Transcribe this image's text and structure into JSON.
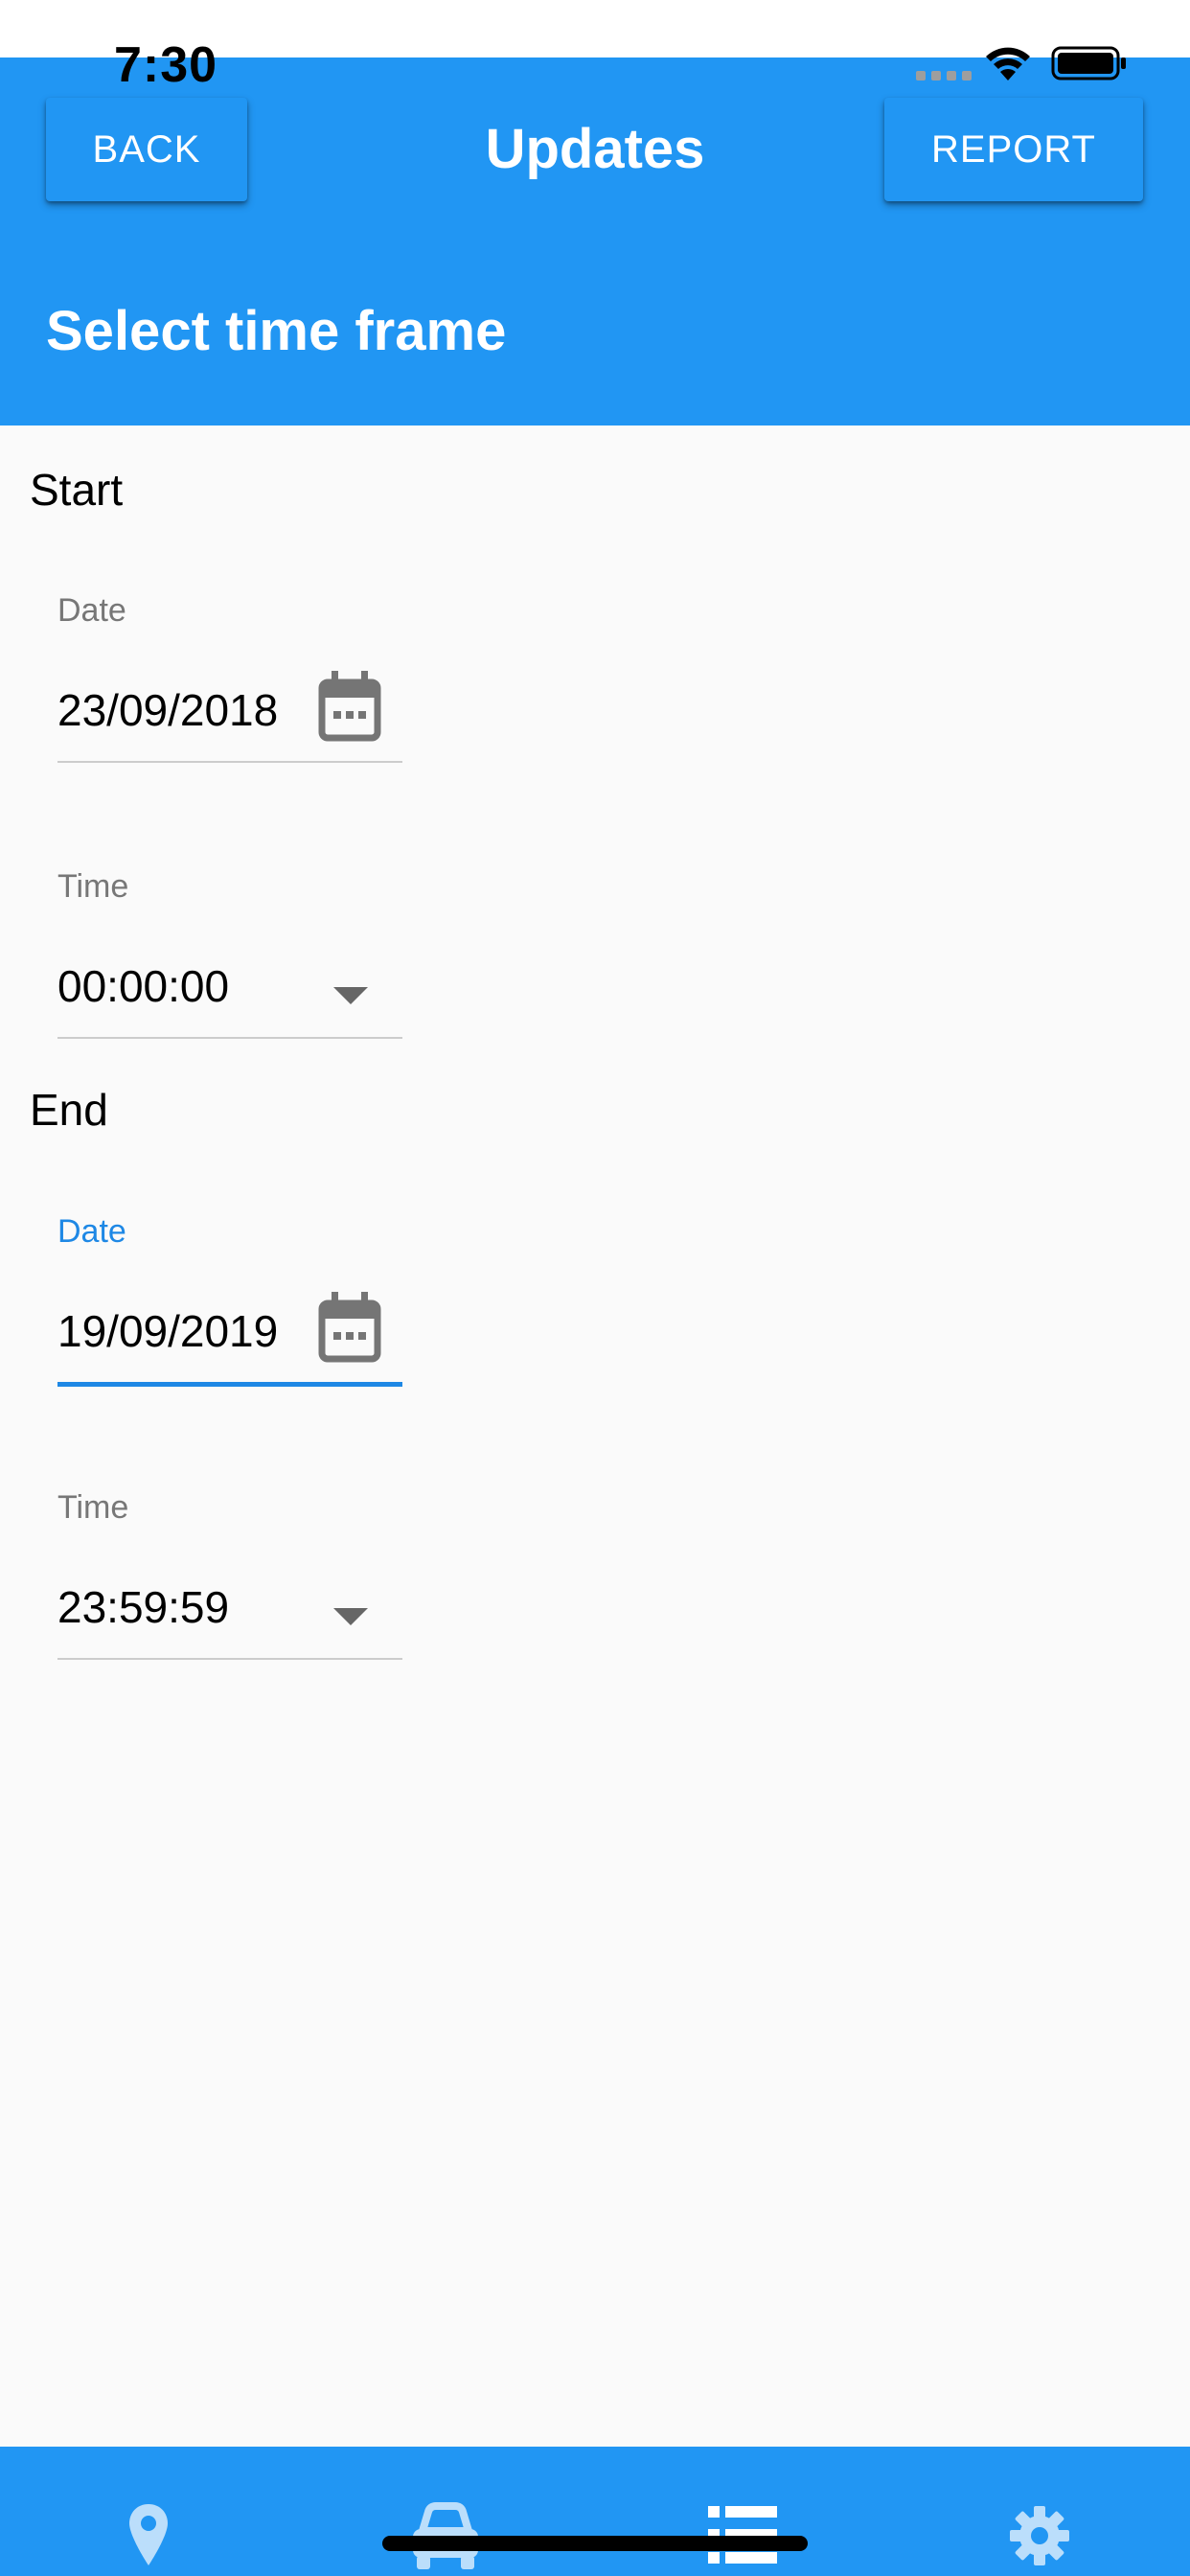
{
  "status_bar": {
    "time": "7:30"
  },
  "header": {
    "back_label": "BACK",
    "title": "Updates",
    "report_label": "REPORT",
    "subtitle": "Select time frame"
  },
  "start": {
    "label": "Start",
    "date_label": "Date",
    "date_value": "23/09/2018",
    "time_label": "Time",
    "time_value": "00:00:00"
  },
  "end": {
    "label": "End",
    "date_label": "Date",
    "date_value": "19/09/2019",
    "time_label": "Time",
    "time_value": "23:59:59"
  },
  "tabbar": {
    "items": [
      {
        "icon": "location-pin-icon"
      },
      {
        "icon": "car-icon"
      },
      {
        "icon": "list-icon",
        "selected": true
      },
      {
        "icon": "gear-icon"
      }
    ]
  },
  "colors": {
    "primary": "#2196f3",
    "accent": "#1e88e5",
    "background": "#fafafa"
  }
}
